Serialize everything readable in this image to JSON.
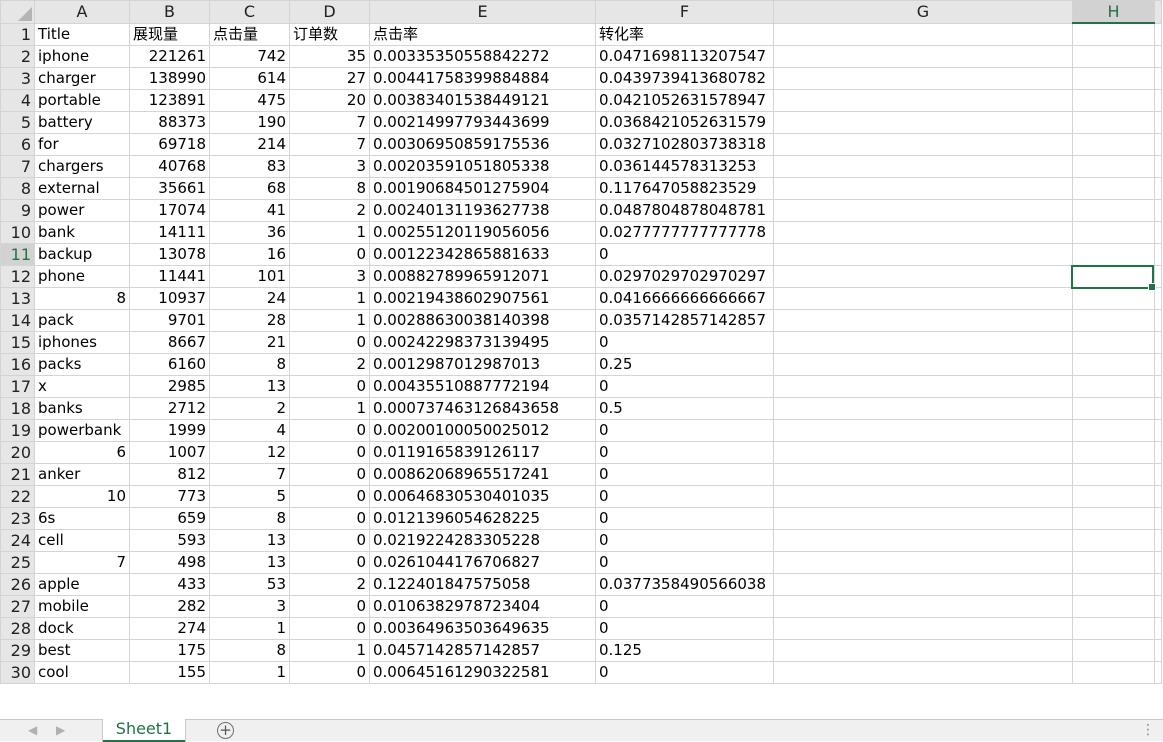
{
  "sheet": {
    "columns": [
      "A",
      "B",
      "C",
      "D",
      "E",
      "F",
      "G",
      "H"
    ],
    "active_column": "H",
    "active_row": 11,
    "rows": [
      {
        "n": "1",
        "cells": [
          "Title",
          "展现量",
          "点击量",
          "订单数",
          "点击率",
          "转化率",
          "",
          ""
        ]
      },
      {
        "n": "2",
        "cells": [
          "iphone",
          "221261",
          "742",
          "35",
          "0.00335350558842272",
          "0.0471698113207547",
          "",
          ""
        ]
      },
      {
        "n": "3",
        "cells": [
          "charger",
          "138990",
          "614",
          "27",
          "0.00441758399884884",
          "0.0439739413680782",
          "",
          ""
        ]
      },
      {
        "n": "4",
        "cells": [
          "portable",
          "123891",
          "475",
          "20",
          "0.00383401538449121",
          "0.0421052631578947",
          "",
          ""
        ]
      },
      {
        "n": "5",
        "cells": [
          "battery",
          "88373",
          "190",
          "7",
          "0.00214997793443699",
          "0.0368421052631579",
          "",
          ""
        ]
      },
      {
        "n": "6",
        "cells": [
          "for",
          "69718",
          "214",
          "7",
          "0.00306950859175536",
          "0.0327102803738318",
          "",
          ""
        ]
      },
      {
        "n": "7",
        "cells": [
          "chargers",
          "40768",
          "83",
          "3",
          "0.00203591051805338",
          "0.036144578313253",
          "",
          ""
        ]
      },
      {
        "n": "8",
        "cells": [
          "external",
          "35661",
          "68",
          "8",
          "0.00190684501275904",
          "0.117647058823529",
          "",
          ""
        ]
      },
      {
        "n": "9",
        "cells": [
          "power",
          "17074",
          "41",
          "2",
          "0.00240131193627738",
          "0.0487804878048781",
          "",
          ""
        ]
      },
      {
        "n": "10",
        "cells": [
          "bank",
          "14111",
          "36",
          "1",
          "0.00255120119056056",
          "0.0277777777777778",
          "",
          ""
        ]
      },
      {
        "n": "11",
        "cells": [
          "backup",
          "13078",
          "16",
          "0",
          "0.00122342865881633",
          "0",
          "",
          ""
        ]
      },
      {
        "n": "12",
        "cells": [
          "phone",
          "11441",
          "101",
          "3",
          "0.00882789965912071",
          "0.0297029702970297",
          "",
          ""
        ]
      },
      {
        "n": "13",
        "cells": [
          "8",
          "10937",
          "24",
          "1",
          "0.00219438602907561",
          "0.0416666666666667",
          "",
          ""
        ]
      },
      {
        "n": "14",
        "cells": [
          "pack",
          "9701",
          "28",
          "1",
          "0.00288630038140398",
          "0.0357142857142857",
          "",
          ""
        ]
      },
      {
        "n": "15",
        "cells": [
          "iphones",
          "8667",
          "21",
          "0",
          "0.00242298373139495",
          "0",
          "",
          ""
        ]
      },
      {
        "n": "16",
        "cells": [
          "packs",
          "6160",
          "8",
          "2",
          "0.0012987012987013",
          "0.25",
          "",
          ""
        ]
      },
      {
        "n": "17",
        "cells": [
          "x",
          "2985",
          "13",
          "0",
          "0.00435510887772194",
          "0",
          "",
          ""
        ]
      },
      {
        "n": "18",
        "cells": [
          "banks",
          "2712",
          "2",
          "1",
          "0.000737463126843658",
          "0.5",
          "",
          ""
        ]
      },
      {
        "n": "19",
        "cells": [
          "powerbank",
          "1999",
          "4",
          "0",
          "0.00200100050025012",
          "0",
          "",
          ""
        ]
      },
      {
        "n": "20",
        "cells": [
          "6",
          "1007",
          "12",
          "0",
          "0.0119165839126117",
          "0",
          "",
          ""
        ]
      },
      {
        "n": "21",
        "cells": [
          "anker",
          "812",
          "7",
          "0",
          "0.00862068965517241",
          "0",
          "",
          ""
        ]
      },
      {
        "n": "22",
        "cells": [
          "10",
          "773",
          "5",
          "0",
          "0.00646830530401035",
          "0",
          "",
          ""
        ]
      },
      {
        "n": "23",
        "cells": [
          "6s",
          "659",
          "8",
          "0",
          "0.0121396054628225",
          "0",
          "",
          ""
        ]
      },
      {
        "n": "24",
        "cells": [
          "cell",
          "593",
          "13",
          "0",
          "0.0219224283305228",
          "0",
          "",
          ""
        ]
      },
      {
        "n": "25",
        "cells": [
          "7",
          "498",
          "13",
          "0",
          "0.0261044176706827",
          "0",
          "",
          ""
        ]
      },
      {
        "n": "26",
        "cells": [
          "apple",
          "433",
          "53",
          "2",
          "0.122401847575058",
          "0.0377358490566038",
          "",
          ""
        ]
      },
      {
        "n": "27",
        "cells": [
          "mobile",
          "282",
          "3",
          "0",
          "0.0106382978723404",
          "0",
          "",
          ""
        ]
      },
      {
        "n": "28",
        "cells": [
          "dock",
          "274",
          "1",
          "0",
          "0.00364963503649635",
          "0",
          "",
          ""
        ]
      },
      {
        "n": "29",
        "cells": [
          "best",
          "175",
          "8",
          "1",
          "0.0457142857142857",
          "0.125",
          "",
          ""
        ]
      },
      {
        "n": "30",
        "cells": [
          "cool",
          "155",
          "1",
          "0",
          "0.00645161290322581",
          "0",
          "",
          ""
        ]
      }
    ]
  },
  "tabs": {
    "prev_icon": "◀",
    "next_icon": "▶",
    "sheet_name": "Sheet1",
    "add_icon": "+",
    "more_icon": "⋮"
  },
  "colors": {
    "accent": "#217346",
    "header_bg": "#e6e6e6",
    "gridline": "#d4d4d4"
  }
}
